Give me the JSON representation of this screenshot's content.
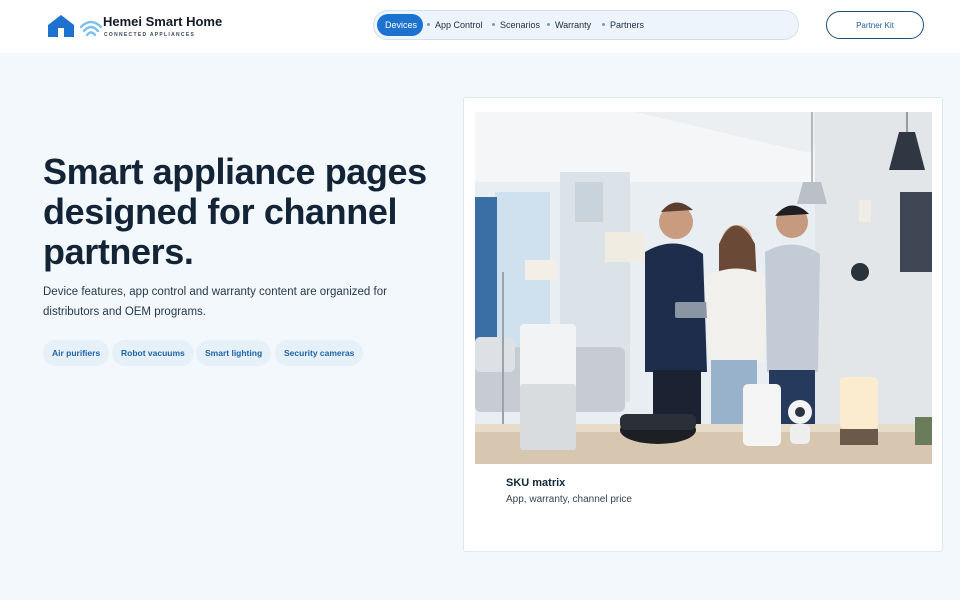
{
  "brand": {
    "name": "Hemei Smart Home",
    "tagline": "CONNECTED APPLIANCES"
  },
  "nav": {
    "items": [
      {
        "label": "Devices",
        "active": true
      },
      {
        "label": "App Control"
      },
      {
        "label": "Scenarios"
      },
      {
        "label": "Warranty"
      },
      {
        "label": "Partners"
      }
    ]
  },
  "header": {
    "cta_label": "Partner Kit"
  },
  "hero": {
    "title": "Smart appliance pages designed for channel partners.",
    "description": "Device features, app control and warranty content are organized for distributors and OEM programs.",
    "chips": [
      "Air purifiers",
      "Robot vacuums",
      "Smart lighting",
      "Security cameras"
    ]
  },
  "card": {
    "title": "SKU matrix",
    "subtitle": "App, warranty, channel price"
  },
  "colors": {
    "accent": "#1e72cf",
    "page_bg": "#f3f8fc",
    "chip_text": "#1e63a8"
  }
}
